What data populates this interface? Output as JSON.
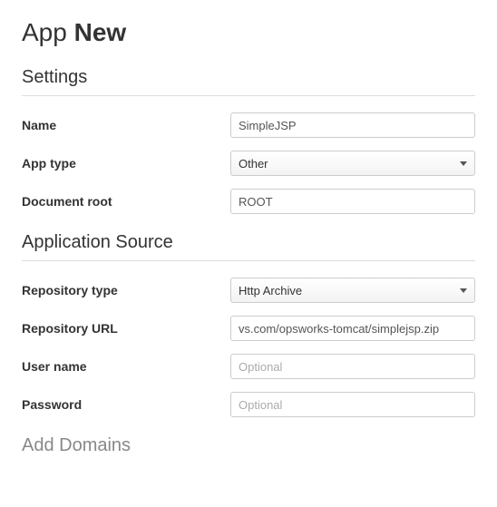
{
  "page_title": {
    "prefix": "App",
    "name": "New"
  },
  "sections": {
    "settings": {
      "heading": "Settings",
      "fields": {
        "name": {
          "label": "Name",
          "value": "SimpleJSP"
        },
        "app_type": {
          "label": "App type",
          "selected": "Other"
        },
        "document_root": {
          "label": "Document root",
          "value": "ROOT"
        }
      }
    },
    "app_source": {
      "heading": "Application Source",
      "fields": {
        "repo_type": {
          "label": "Repository type",
          "selected": "Http Archive"
        },
        "repo_url": {
          "label": "Repository URL",
          "value": "vs.com/opsworks-tomcat/simplejsp.zip"
        },
        "user_name": {
          "label": "User name",
          "value": "",
          "placeholder": "Optional"
        },
        "password": {
          "label": "Password",
          "value": "",
          "placeholder": "Optional"
        }
      }
    },
    "domains": {
      "heading": "Add Domains"
    }
  }
}
